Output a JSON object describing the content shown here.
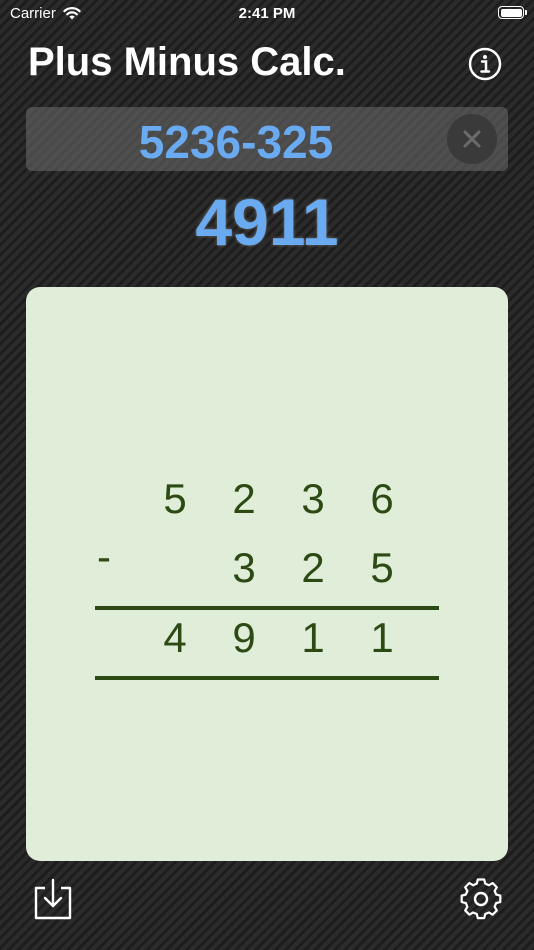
{
  "status_bar": {
    "carrier": "Carrier",
    "time": "2:41 PM"
  },
  "header": {
    "title": "Plus Minus Calc."
  },
  "expression": {
    "value": "5236-325"
  },
  "result": {
    "value": "4911"
  },
  "worksheet": {
    "operand_1": [
      "5",
      "2",
      "3",
      "6"
    ],
    "operator": "-",
    "operand_2": [
      "3",
      "2",
      "5"
    ],
    "result": [
      "4",
      "9",
      "1",
      "1"
    ]
  },
  "icons": {
    "info": "info-icon",
    "clear": "close-icon",
    "save": "save-download-icon",
    "settings": "gear-icon",
    "wifi": "wifi-icon",
    "battery": "battery-icon"
  },
  "colors": {
    "accent": "#6aaaf0",
    "panel": "#e0eed9",
    "digits": "#2d4a14"
  }
}
